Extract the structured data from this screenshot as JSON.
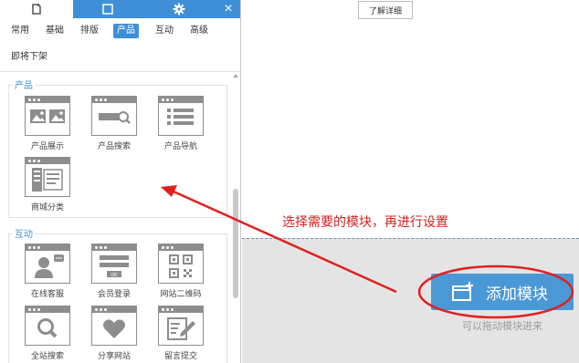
{
  "panel": {
    "close_glyph": "×",
    "categories": [
      "常用",
      "基础",
      "排版",
      "产品",
      "互动",
      "高级",
      "即将下架"
    ],
    "active_category": "产品",
    "groups": [
      {
        "title": "产品",
        "modules": [
          {
            "label": "产品展示",
            "icon": "image-gallery-icon"
          },
          {
            "label": "产品搜索",
            "icon": "search-bar-icon"
          },
          {
            "label": "产品导航",
            "icon": "list-nav-icon"
          },
          {
            "label": "商城分类",
            "icon": "category-icon"
          }
        ]
      },
      {
        "title": "互动",
        "modules": [
          {
            "label": "在线客服",
            "icon": "customer-service-icon"
          },
          {
            "label": "会员登录",
            "icon": "login-form-icon"
          },
          {
            "label": "网站二维码",
            "icon": "qr-code-icon"
          },
          {
            "label": "全站搜索",
            "icon": "magnifier-icon"
          },
          {
            "label": "分享网站",
            "icon": "heart-icon"
          },
          {
            "label": "留言提交",
            "icon": "edit-icon"
          }
        ]
      }
    ]
  },
  "right": {
    "learn_more": "了解详细",
    "add_module": "添加模块",
    "drag_hint": "可以拖动模块进来",
    "annotation": "选择需要的模块，再进行设置"
  },
  "colors": {
    "accent": "#3f8fd8",
    "button": "#4a98d6",
    "annotation": "#d32020",
    "icon_gray": "#8d8d8d"
  }
}
